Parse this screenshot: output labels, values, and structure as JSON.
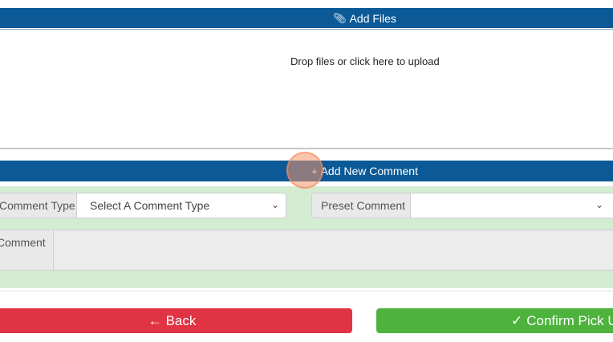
{
  "files": {
    "add_files_icon": "paperclip-icon",
    "add_files_label": "Add Files",
    "dropzone_text": "Drop files or click here to upload"
  },
  "comments": {
    "add_comment_icon": "plus-icon",
    "add_comment_label": "Add New Comment",
    "comment_type_label": "Comment Type",
    "comment_type_selected": "Select A Comment Type",
    "preset_comment_label": "Preset Comment",
    "preset_comment_selected": "",
    "comment_label": "Comment",
    "comment_value": ""
  },
  "actions": {
    "back_label": "Back",
    "back_icon": "arrow-left-icon",
    "confirm_label": "Confirm Pick Up",
    "confirm_icon": "check-icon"
  },
  "colors": {
    "header_bar": "#0b5a97",
    "panel_bg": "#d4ecd2",
    "back_button": "#e03444",
    "confirm_button": "#4db33c"
  }
}
